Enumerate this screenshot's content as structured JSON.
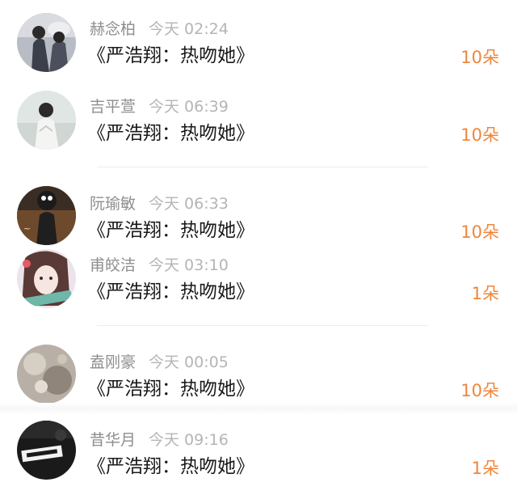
{
  "items": [
    {
      "name": "赫念柏",
      "time": "今天 02:24",
      "title": "《严浩翔：热吻她》",
      "count": "10朵"
    },
    {
      "name": "吉平萱",
      "time": "今天 06:39",
      "title": "《严浩翔：热吻她》",
      "count": "10朵"
    },
    {
      "name": "阮瑜敏",
      "time": "今天 06:33",
      "title": "《严浩翔：热吻她》",
      "count": "10朵"
    },
    {
      "name": "甫皎洁",
      "time": "今天 03:10",
      "title": "《严浩翔：热吻她》",
      "count": "1朵"
    },
    {
      "name": "盍刚豪",
      "time": "今天 00:05",
      "title": "《严浩翔：热吻她》",
      "count": "10朵"
    },
    {
      "name": "昔华月",
      "time": "今天 09:16",
      "title": "《严浩翔：热吻她》",
      "count": "1朵"
    }
  ],
  "colors": {
    "name": "#8e8e8e",
    "time": "#b5b5b5",
    "title": "#1a1a1a",
    "count": "#f0863a"
  }
}
